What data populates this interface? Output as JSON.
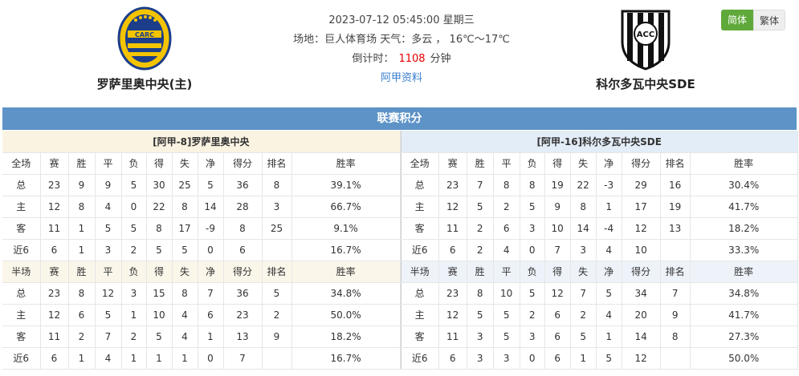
{
  "match": {
    "datetime": "2023-07-12 05:45:00 星期三",
    "venue_line": "场地：巨人体育场 天气：多云 ， 16℃～17℃",
    "countdown_label": "倒计时：",
    "countdown_value": "1108",
    "countdown_unit": "分钟",
    "league_link": "阿甲资料"
  },
  "home_team": {
    "name": "罗萨里奥中央(主)",
    "logo_text": "CARC"
  },
  "away_team": {
    "name": "科尔多瓦中央SDE",
    "logo_text": "ACC"
  },
  "lang": {
    "simplified": "简体",
    "traditional": "繁体"
  },
  "section_title": "联赛积分",
  "colors": {
    "section_bar": "#5d93c7",
    "home_label": "#e60000",
    "away_label": "#1f5fb8",
    "lang_active": "#5fa93a"
  },
  "home_table": {
    "title": "[阿甲-8]罗萨里奥中央",
    "full_headers": [
      "全场",
      "赛",
      "胜",
      "平",
      "负",
      "得",
      "失",
      "净",
      "得分",
      "排名",
      "胜率"
    ],
    "full_rows": [
      [
        "总",
        "23",
        "9",
        "9",
        "5",
        "30",
        "25",
        "5",
        "36",
        "8",
        "39.1%"
      ],
      [
        "主",
        "12",
        "8",
        "4",
        "0",
        "22",
        "8",
        "14",
        "28",
        "3",
        "66.7%"
      ],
      [
        "客",
        "11",
        "1",
        "5",
        "5",
        "8",
        "17",
        "-9",
        "8",
        "25",
        "9.1%"
      ],
      [
        "近6",
        "6",
        "1",
        "3",
        "2",
        "5",
        "5",
        "0",
        "6",
        "",
        "16.7%"
      ]
    ],
    "half_headers": [
      "半场",
      "赛",
      "胜",
      "平",
      "负",
      "得",
      "失",
      "净",
      "得分",
      "排名",
      "胜率"
    ],
    "half_rows": [
      [
        "总",
        "23",
        "8",
        "12",
        "3",
        "15",
        "8",
        "7",
        "36",
        "5",
        "34.8%"
      ],
      [
        "主",
        "12",
        "6",
        "5",
        "1",
        "10",
        "4",
        "6",
        "23",
        "2",
        "50.0%"
      ],
      [
        "客",
        "11",
        "2",
        "7",
        "2",
        "5",
        "4",
        "1",
        "13",
        "9",
        "18.2%"
      ],
      [
        "近6",
        "6",
        "1",
        "4",
        "1",
        "1",
        "1",
        "0",
        "7",
        "",
        "16.7%"
      ]
    ]
  },
  "away_table": {
    "title": "[阿甲-16]科尔多瓦中央SDE",
    "full_headers": [
      "全场",
      "赛",
      "胜",
      "平",
      "负",
      "得",
      "失",
      "净",
      "得分",
      "排名",
      "胜率"
    ],
    "full_rows": [
      [
        "总",
        "23",
        "7",
        "8",
        "8",
        "19",
        "22",
        "-3",
        "29",
        "16",
        "30.4%"
      ],
      [
        "主",
        "12",
        "5",
        "2",
        "5",
        "9",
        "8",
        "1",
        "17",
        "19",
        "41.7%"
      ],
      [
        "客",
        "11",
        "2",
        "6",
        "3",
        "10",
        "14",
        "-4",
        "12",
        "13",
        "18.2%"
      ],
      [
        "近6",
        "6",
        "2",
        "4",
        "0",
        "7",
        "3",
        "4",
        "10",
        "",
        "33.3%"
      ]
    ],
    "half_headers": [
      "半场",
      "赛",
      "胜",
      "平",
      "负",
      "得",
      "失",
      "净",
      "得分",
      "排名",
      "胜率"
    ],
    "half_rows": [
      [
        "总",
        "23",
        "8",
        "10",
        "5",
        "12",
        "7",
        "5",
        "34",
        "7",
        "34.8%"
      ],
      [
        "主",
        "12",
        "5",
        "5",
        "2",
        "6",
        "2",
        "4",
        "20",
        "9",
        "41.7%"
      ],
      [
        "客",
        "11",
        "3",
        "5",
        "3",
        "6",
        "5",
        "1",
        "14",
        "8",
        "27.3%"
      ],
      [
        "近6",
        "6",
        "3",
        "3",
        "0",
        "6",
        "1",
        "5",
        "12",
        "",
        "50.0%"
      ]
    ]
  }
}
